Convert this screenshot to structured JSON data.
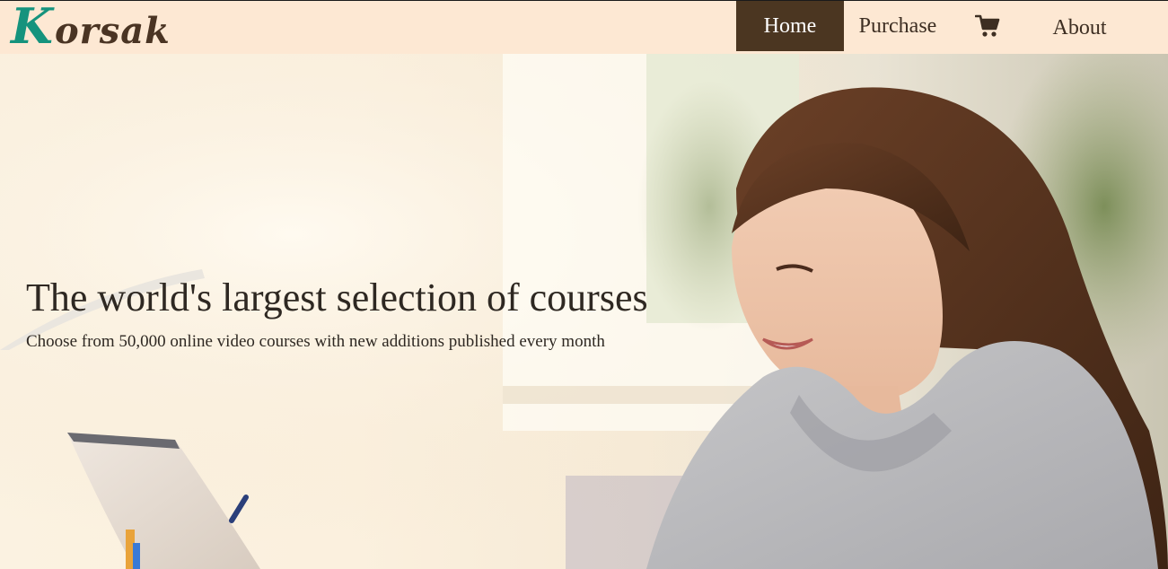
{
  "brand": {
    "initial": "K",
    "rest": "orsak",
    "initial_color": "#15937d",
    "text_color": "#4a3423"
  },
  "nav": {
    "home": "Home",
    "purchase": "Purchase",
    "cart_icon": "shopping-cart-icon",
    "about": "About",
    "active": "Home",
    "active_bg": "#4b3621",
    "bar_bg": "#fde8d3"
  },
  "hero": {
    "title": "The world's largest selection of courses",
    "subtitle": "Choose from 50,000 online video courses with new additions published every month"
  }
}
